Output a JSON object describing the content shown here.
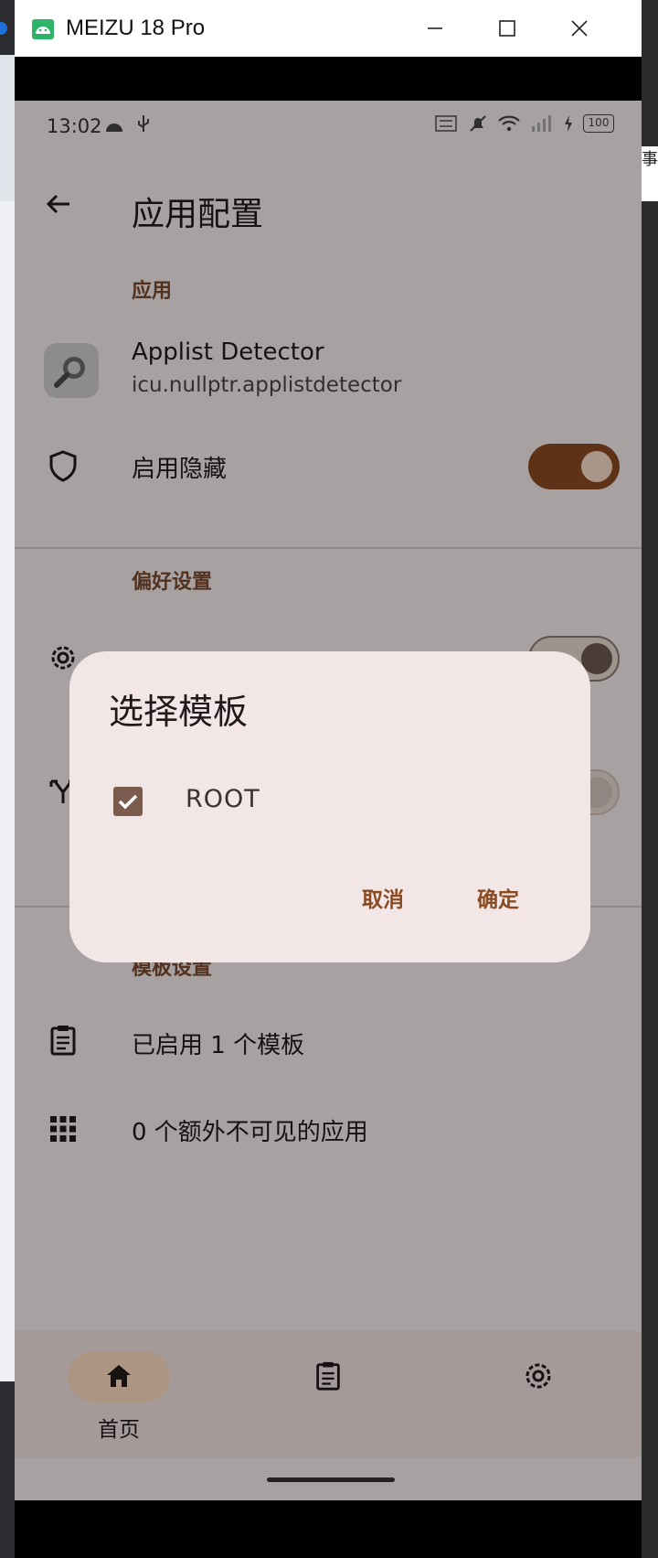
{
  "window": {
    "title": "MEIZU 18 Pro"
  },
  "desktop": {
    "right_fragment": "事."
  },
  "status_bar": {
    "time": "13:02",
    "battery": "100"
  },
  "app_bar": {
    "title": "应用配置"
  },
  "sections": {
    "app": {
      "header": "应用"
    },
    "preferences": {
      "header": "偏好设置"
    },
    "templates": {
      "header": "模板设置"
    }
  },
  "app_item": {
    "name": "Applist Detector",
    "package": "icu.nullptr.applistdetector"
  },
  "enable_hide": {
    "label": "启用隐藏",
    "checked": true
  },
  "template_rows": {
    "enabled": "已启用 1 个模板",
    "invisible": "0 个额外不可见的应用"
  },
  "dialog": {
    "title": "选择模板",
    "options": [
      {
        "label": "ROOT",
        "checked": true
      }
    ],
    "cancel": "取消",
    "confirm": "确定"
  },
  "bottom_nav": {
    "items": [
      {
        "label": "首页",
        "selected": true
      },
      {
        "label": "",
        "selected": false
      },
      {
        "label": "",
        "selected": false
      }
    ]
  },
  "colors": {
    "accent": "#7a4a2e",
    "switch_on": "#8a4b22",
    "surface": "#f6eeee"
  }
}
